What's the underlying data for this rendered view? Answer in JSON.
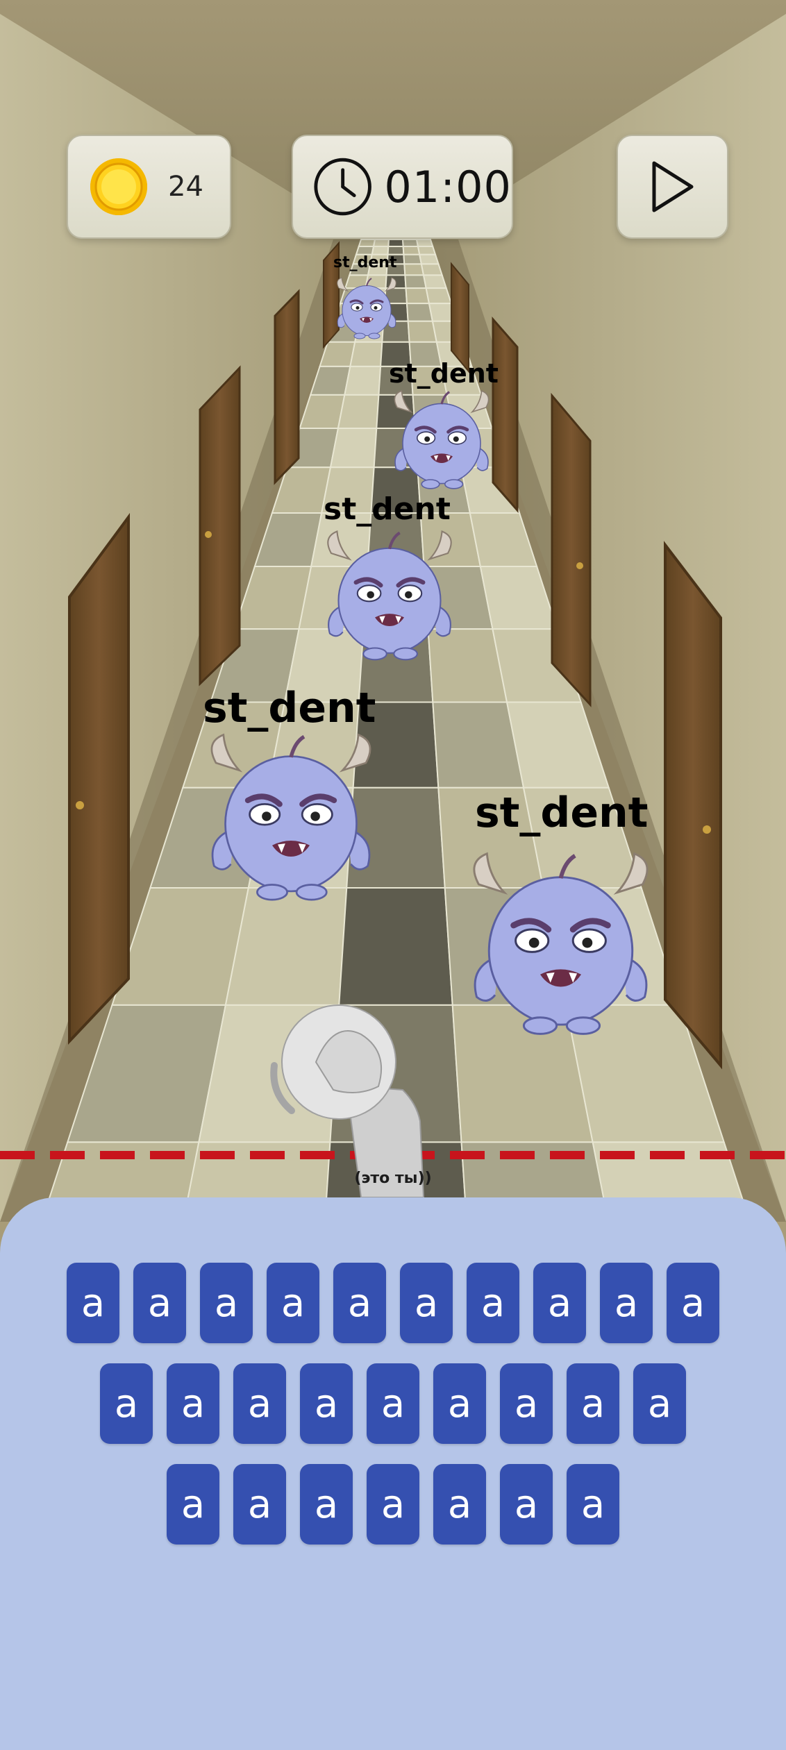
{
  "hud": {
    "coins": "24",
    "timer": "01:00",
    "icons": {
      "coin": "coin-icon",
      "clock": "clock-icon",
      "play": "play-icon"
    }
  },
  "monsters": [
    {
      "name": "st_dent"
    },
    {
      "name": "st_dent"
    },
    {
      "name": "st_dent"
    },
    {
      "name": "st_dent"
    },
    {
      "name": "st_dent"
    }
  ],
  "player": {
    "caption": "(это ты))"
  },
  "keyboard": {
    "rows": [
      [
        "a",
        "a",
        "a",
        "a",
        "a",
        "a",
        "a",
        "a",
        "a",
        "a"
      ],
      [
        "a",
        "a",
        "a",
        "a",
        "a",
        "a",
        "a",
        "a",
        "a"
      ],
      [
        "a",
        "a",
        "a",
        "a",
        "a",
        "a",
        "a"
      ]
    ]
  },
  "colors": {
    "panel": "#b5c5e8",
    "key": "#3550b0",
    "key_text": "#ffffff",
    "danger_line": "#c8141c",
    "monster_body": "#a7aee6"
  }
}
